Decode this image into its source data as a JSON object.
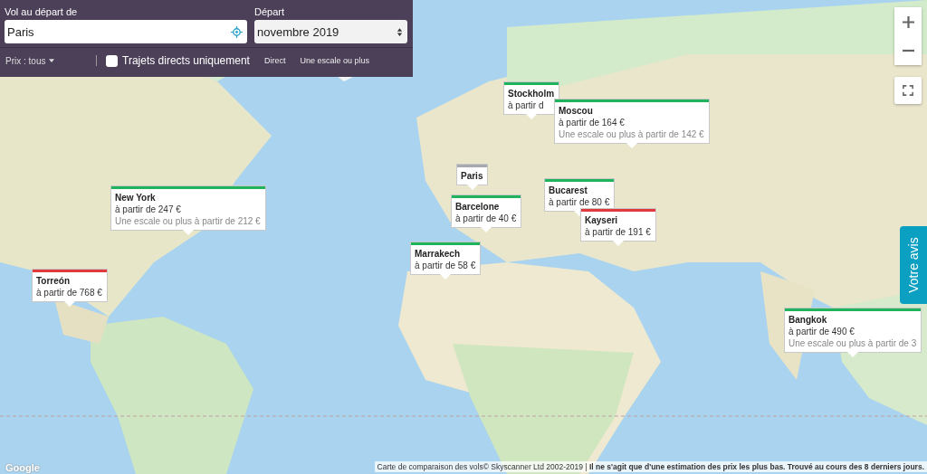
{
  "search": {
    "from_label": "Vol au départ de",
    "from_value": "Paris",
    "date_label": "Départ",
    "date_value": "novembre 2019"
  },
  "filters": {
    "price": "Prix : tous",
    "direct_only": {
      "label": "Trajets directs uniquement",
      "checked": false
    },
    "legend": [
      "Direct",
      "Une escale ou plus"
    ]
  },
  "destinations": [
    {
      "city": "Stockholm",
      "price": "à partir d",
      "color": "#1fb45c"
    },
    {
      "city": "Moscou",
      "price": "à partir de 164 €",
      "stopover": "Une escale ou plus à partir de 142 €",
      "color": "#1fb45c"
    },
    {
      "city": "Paris",
      "color": "#a8a8b0"
    },
    {
      "city": "Bucarest",
      "price": "à partir de 80 €",
      "color": "#1fb45c"
    },
    {
      "city": "Barcelone",
      "price": "à partir de 40 €",
      "color": "#1fb45c"
    },
    {
      "city": "Kayseri",
      "price": "à partir de 191 €",
      "color": "#e0393e"
    },
    {
      "city": "Marrakech",
      "price": "à partir de 58 €",
      "color": "#1fb45c"
    },
    {
      "city": "New York",
      "price": "à partir de 247 €",
      "stopover": "Une escale ou plus à partir de 212 €",
      "color": "#1fb45c"
    },
    {
      "city": "Torreón",
      "price": "à partir de 768 €",
      "color": "#e0393e"
    },
    {
      "city": "Bangkok",
      "price": "à partir de 490 €",
      "stopover": "Une escale ou plus à partir de 3",
      "color": "#1fb45c"
    }
  ],
  "feedback_tab": "Votre avis",
  "footer": "Carte de comparaison des vols© Skyscanner Ltd 2002-2019 | **Il ne s'agit que d'une estimation des prix les plus bas. Trouvé au cours des 8 derniers jours.**",
  "logo": "Google"
}
